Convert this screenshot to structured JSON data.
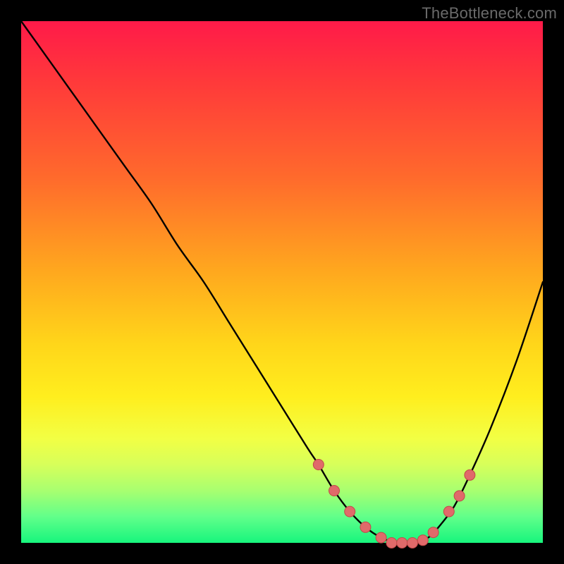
{
  "watermark": "TheBottleneck.com",
  "colors": {
    "background": "#000000",
    "gradient_top": "#ff1a49",
    "gradient_bottom": "#17f57d",
    "curve": "#000000",
    "marker_fill": "#e06a6a",
    "marker_stroke": "#c24848"
  },
  "chart_data": {
    "type": "line",
    "title": "",
    "xlabel": "",
    "ylabel": "",
    "xlim": [
      0,
      100
    ],
    "ylim": [
      0,
      100
    ],
    "grid": false,
    "legend": false,
    "series": [
      {
        "name": "bottleneck-curve",
        "x": [
          0,
          5,
          10,
          15,
          20,
          25,
          30,
          35,
          40,
          45,
          50,
          55,
          57,
          60,
          63,
          66,
          69,
          72,
          75,
          78,
          80,
          83,
          86,
          90,
          95,
          100
        ],
        "values": [
          100,
          93,
          86,
          79,
          72,
          65,
          57,
          50,
          42,
          34,
          26,
          18,
          15,
          10,
          6,
          3,
          1,
          0,
          0,
          1,
          3,
          7,
          13,
          22,
          35,
          50
        ]
      }
    ],
    "markers": {
      "name": "highlighted-points",
      "x": [
        57,
        60,
        63,
        66,
        69,
        71,
        73,
        75,
        77,
        79,
        82,
        84,
        86
      ],
      "values": [
        15,
        10,
        6,
        3,
        1,
        0,
        0,
        0,
        0.5,
        2,
        6,
        9,
        13
      ]
    }
  }
}
